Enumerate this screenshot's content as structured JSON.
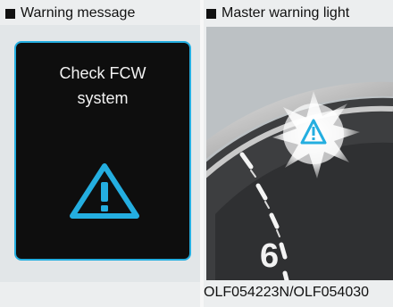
{
  "panels": {
    "left": {
      "heading": "Warning message",
      "message": "Check FCW system",
      "icon": "warning-triangle-icon"
    },
    "right": {
      "heading": "Master warning light",
      "gauge_number": "6",
      "icon": "master-warning-icon"
    }
  },
  "caption": "OLF054223N/OLF054030",
  "colors": {
    "accent": "#24aee0",
    "screen_bg": "#0e0e0e",
    "page_bg": "#eceeef"
  }
}
